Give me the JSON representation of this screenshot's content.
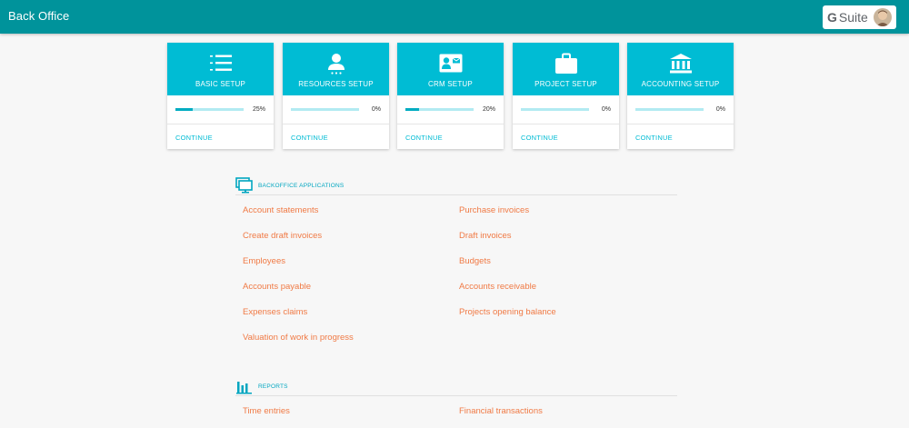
{
  "header": {
    "title": "Back Office",
    "gsuite_g": "G",
    "gsuite_text": "Suite"
  },
  "cards": [
    {
      "title": "BASIC SETUP",
      "progress": 25,
      "progress_label": "25%",
      "action": "CONTINUE",
      "icon": "list-icon"
    },
    {
      "title": "RESOURCES SETUP",
      "progress": 0,
      "progress_label": "0%",
      "action": "CONTINUE",
      "icon": "person-icon"
    },
    {
      "title": "CRM SETUP",
      "progress": 20,
      "progress_label": "20%",
      "action": "CONTINUE",
      "icon": "contact-card-icon"
    },
    {
      "title": "PROJECT SETUP",
      "progress": 0,
      "progress_label": "0%",
      "action": "CONTINUE",
      "icon": "briefcase-icon"
    },
    {
      "title": "ACCOUNTING SETUP",
      "progress": 0,
      "progress_label": "0%",
      "action": "CONTINUE",
      "icon": "bank-icon"
    }
  ],
  "applications": {
    "title": "BACKOFFICE APPLICATIONS",
    "icon": "monitor-icon",
    "left": [
      "Account statements",
      "Create draft invoices",
      "Employees",
      "Accounts payable",
      "Expenses claims",
      "Valuation of work in progress"
    ],
    "right": [
      "Purchase invoices",
      "Draft invoices",
      "Budgets",
      "Accounts receivable",
      "Projects opening balance"
    ]
  },
  "reports": {
    "title": "REPORTS",
    "icon": "bar-chart-icon",
    "left": [
      "Time entries"
    ],
    "right": [
      "Financial transactions"
    ]
  },
  "colors": {
    "topbar": "#00939b",
    "card_header": "#00bcd4",
    "link": "#f07a45",
    "accent": "#00a6c0"
  }
}
